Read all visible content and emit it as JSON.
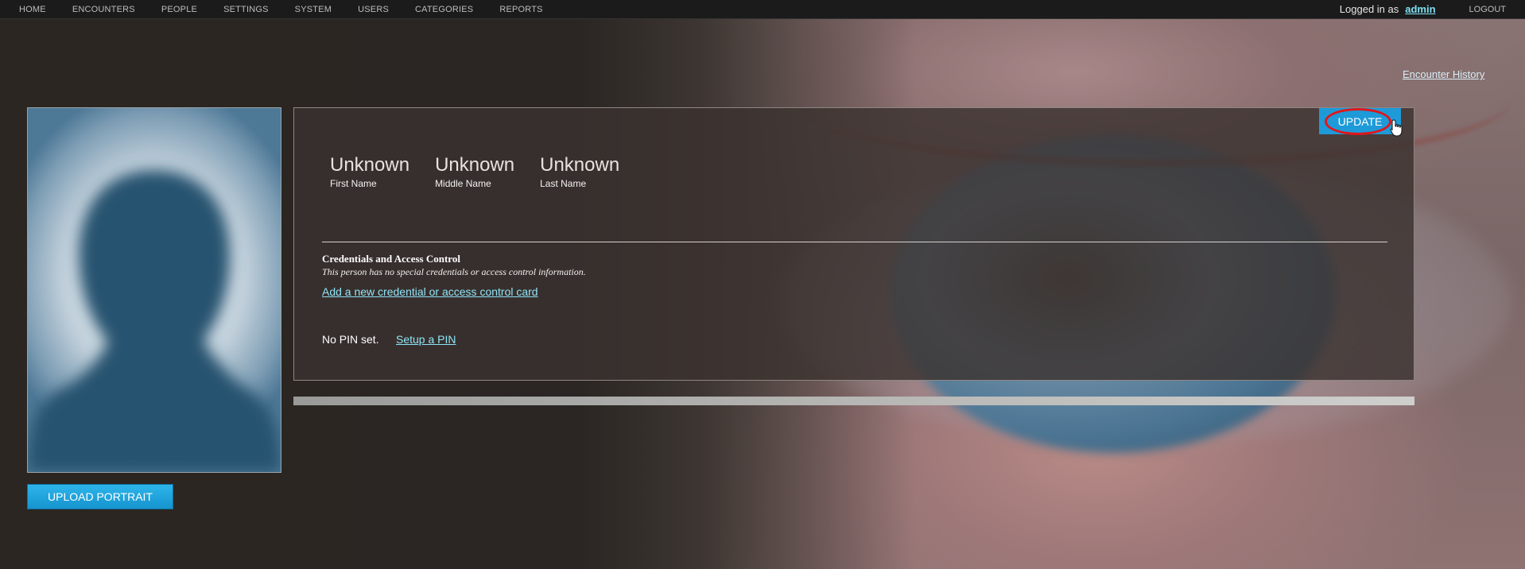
{
  "nav": {
    "items": [
      {
        "label": "HOME"
      },
      {
        "label": "ENCOUNTERS"
      },
      {
        "label": "PEOPLE"
      },
      {
        "label": "SETTINGS"
      },
      {
        "label": "SYSTEM"
      },
      {
        "label": "USERS"
      },
      {
        "label": "CATEGORIES"
      },
      {
        "label": "REPORTS"
      }
    ],
    "logged_in_label": "Logged in as",
    "username": "admin",
    "logout_label": "LOGOUT"
  },
  "encounter_history_link": "Encounter History",
  "portrait": {
    "upload_label": "UPLOAD PORTRAIT",
    "icon": "silhouette-icon"
  },
  "person": {
    "update_label": "UPDATE",
    "first_name": "Unknown",
    "first_name_label": "First Name",
    "middle_name": "Unknown",
    "middle_name_label": "Middle Name",
    "last_name": "Unknown",
    "last_name_label": "Last Name"
  },
  "credentials": {
    "title": "Credentials and Access Control",
    "description": "This person has no special credentials or access control information.",
    "add_link": "Add a new credential or access control card"
  },
  "pin": {
    "status": "No PIN set.",
    "setup_link": "Setup a PIN"
  },
  "colors": {
    "accent": "#1e9ad8",
    "link": "#8fe4f6",
    "highlight_ring": "#e0161a",
    "topbar": "#1b1b1b"
  }
}
